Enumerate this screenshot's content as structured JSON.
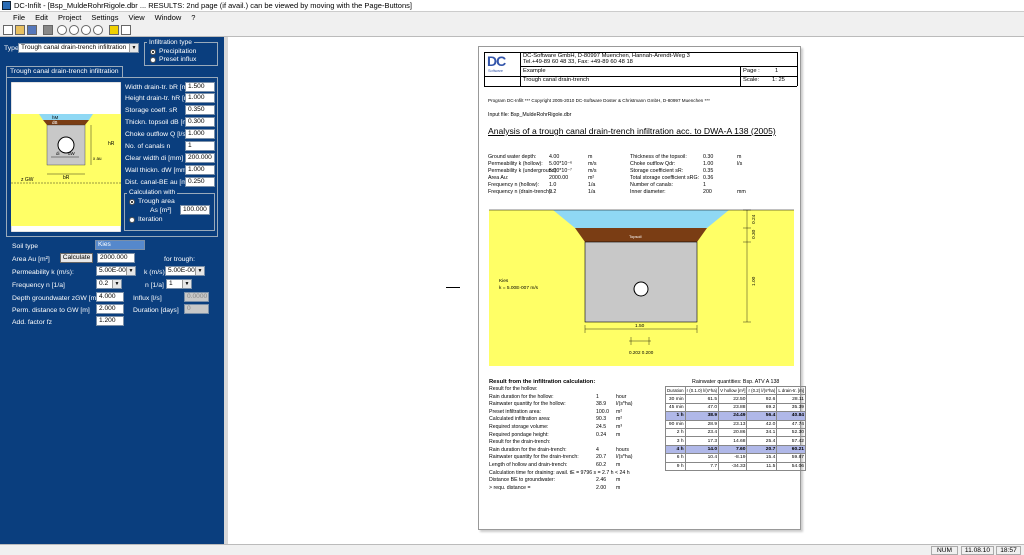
{
  "window": {
    "title": "DC-Infilt  -  [Bsp_MuldeRohrRigole.dbr ... RESULTS: 2nd page (if avail.) can be viewed by moving with the Page-Buttons]"
  },
  "menu": [
    "File",
    "Edit",
    "Project",
    "Settings",
    "View",
    "Window",
    "?"
  ],
  "left": {
    "type_label": "Type",
    "type_value": "Trough canal drain-trench infiltration",
    "infil_group": "Infiltration type",
    "infil_options": [
      "Precipitation",
      "Preset influx"
    ],
    "tab": "Trough canal drain-trench infiltration",
    "fields": [
      {
        "label": "Width drain-tr. bR [m]",
        "value": "1.500"
      },
      {
        "label": "Height drain-tr. hR [m]",
        "value": "1.000"
      },
      {
        "label": "Storage coeff. sR",
        "value": "0.350"
      },
      {
        "label": "Thickn. topsoil dB [m]",
        "value": "0.300"
      },
      {
        "label": "Choke outflow Q [l/s]",
        "value": "1.000"
      },
      {
        "label": "No. of canals n",
        "value": "1"
      },
      {
        "label": "Clear width di [mm]",
        "value": "200.000"
      },
      {
        "label": "Wall thickn. dW [mm]",
        "value": "1.000"
      },
      {
        "label": "Dist. canal-BE au [m]",
        "value": "0.250"
      }
    ],
    "calc_group": "Calculation with",
    "calc_options": [
      "Trough area",
      "Iteration"
    ],
    "as_label": "As [m²]",
    "as_value": "100.000",
    "soil_label": "Soil type",
    "soil_value": "Kies",
    "area_label": "Area Au [m²]",
    "calc_button": "Calculate",
    "area_value": "2000.000",
    "for_trough": "for trough:",
    "perm_label": "Permeability k (m/s):",
    "perm_value": "5.00E-007",
    "k_label": "k (m/s)",
    "k_value": "5.00E-005",
    "freq_label": "Frequency n [1/a]",
    "freq_value": "0.2",
    "n_label": "n [1/a]",
    "n_value": "1",
    "depth_label": "Depth groundwater zGW [m]",
    "depth_value": "4.000",
    "influx_label": "Influx [l/s]",
    "influx_value": "0.0000",
    "perm_dist_label": "Perm. distance to GW [m]",
    "perm_dist_value": "2.000",
    "duration_label": "Duration [days]",
    "duration_value": "0",
    "factor_label": "Add. factor fz",
    "factor_value": "1.200",
    "diagram": {
      "hM": "hM",
      "dB": "dB",
      "hR": "hR",
      "xau": "x au",
      "di": "di",
      "dW": "dW",
      "bR": "bR",
      "zGW": "z GW"
    }
  },
  "report": {
    "company": "DC-Software GmbH, D-80997 Muenchen, Hannah-Arendt-Weg 3",
    "phone": "Tel.+49-89 60 48 33, Fax: +49-89 60 48 18",
    "example": "Example",
    "subtitle": "Trough canal drain-trench",
    "page_label": "Page :",
    "page_value": "1",
    "scale_label": "Scale:",
    "scale_value": "1: 25",
    "logo": "DC",
    "logo_sub": "Software",
    "program": "Program DC-Infilt *** Copyright 2005-2010 DC-Software Doster & Christmann GmbH, D-80997 Muenchen ***",
    "input_file": "Input file: Bsp_MuldeRohrRigole.dbr",
    "heading": "Analysis of a trough canal drain-trench infiltration acc. to DWA-A 138 (2005)",
    "params_left": [
      [
        "Ground water depth:",
        "4.00",
        "m"
      ],
      [
        "Permeability k (hollow):",
        "5.00*10⁻⁶",
        "m/s"
      ],
      [
        "Permeability k (underground):",
        "5.00*10⁻⁷",
        "m/s"
      ],
      [
        "Area Au:",
        "2000.00",
        "m²"
      ],
      [
        "Frequency n (hollow):",
        "1.0",
        "1/a"
      ],
      [
        "Frequency n (drain-trench):",
        "0.2",
        "1/a"
      ]
    ],
    "params_right": [
      [
        "Thickness of the topsoil:",
        "0.30",
        "m"
      ],
      [
        "Choke outflow Qdr:",
        "1.00",
        "l/s"
      ],
      [
        "Storage coefficient sR:",
        "0.35",
        ""
      ],
      [
        "Total storage coefficient sRG:",
        "0.36",
        ""
      ],
      [
        "Number of canals:",
        "1",
        ""
      ],
      [
        "Inner diameter:",
        "200",
        "mm"
      ]
    ],
    "drawing": {
      "topsoil": "Topsoil",
      "soil": "Kies",
      "perm": "k = 5.00E-007 m/s",
      "dim_w": "1.50",
      "dim_h1": "1.00",
      "dim_h2": "0.30",
      "dim_h3": "0.24",
      "dim_pipe": "0.202  0.200"
    },
    "results_title": "Result from the infiltration calculation:",
    "results": [
      [
        "Result for the hollow:",
        "",
        ""
      ],
      [
        "Rain duration for the hollow:",
        "1",
        "hour"
      ],
      [
        "Rainwater quantity for the hollow:",
        "38.9",
        "l/(s*ha)"
      ],
      [
        "Preset infiltration area:",
        "100.0",
        "m²"
      ],
      [
        "Calculated infiltration area:",
        "90.3",
        "m²"
      ],
      [
        "Required storage volume:",
        "24.5",
        "m³"
      ],
      [
        "Required pondage height:",
        "0.24",
        "m"
      ],
      [
        "Result for the drain-trench:",
        "",
        ""
      ],
      [
        "Rain duration for the drain-trench:",
        "4",
        "hours"
      ],
      [
        "Rainwater quantity for the drain-trench:",
        "20.7",
        "l/(s*ha)"
      ],
      [
        "Length of hollow and drain-trench:",
        "60.2",
        "m"
      ],
      [
        "Calculation time for draining: avail. tE = 9796 s = 2.7 h < 24 h",
        "",
        ""
      ],
      [
        "Distance BE to groundwater:",
        "2.46",
        "m"
      ],
      [
        " > requ. distance =",
        "2.00",
        "m"
      ]
    ],
    "rain_title": "Rainwater quantities: Bsp. ATV A 138",
    "rain_header": [
      "Duration",
      "r (0.1.0) l/(s*ha)",
      "V hollow [m³]",
      "r (0.2) l/(s*ha)",
      "L drain-tr. [m]"
    ],
    "rain_rows": [
      [
        "30 min",
        "61.5",
        "22.50",
        "92.6",
        "28.11"
      ],
      [
        "45 min",
        "47.0",
        "23.88",
        "69.2",
        "35.39"
      ],
      [
        "1 h",
        "38.9",
        "24.49",
        "56.4",
        "40.84"
      ],
      [
        "90 min",
        "28.9",
        "23.13",
        "42.0",
        "47.74"
      ],
      [
        "2 h",
        "23.4",
        "20.86",
        "34.1",
        "52.30"
      ],
      [
        "3 h",
        "17.3",
        "14.68",
        "25.4",
        "57.42"
      ],
      [
        "4 h",
        "14.0",
        "7.60",
        "20.7",
        "60.21"
      ],
      [
        "6 h",
        "10.4",
        "-8.19",
        "15.4",
        "59.87"
      ],
      [
        "9 h",
        "7.7",
        "-34.33",
        "11.5",
        "54.06"
      ]
    ],
    "rain_highlight": [
      2,
      6
    ]
  },
  "status": {
    "num": "NUM",
    "date": "11.08.10",
    "time": "18:57"
  },
  "colors": {
    "panel": "#0a3e7e",
    "water": "#8fd8f4",
    "sand": "#ffff66",
    "topsoil": "#7a3d14",
    "gravel": "#c8c8c8",
    "highlight": "#b0b8e8"
  }
}
